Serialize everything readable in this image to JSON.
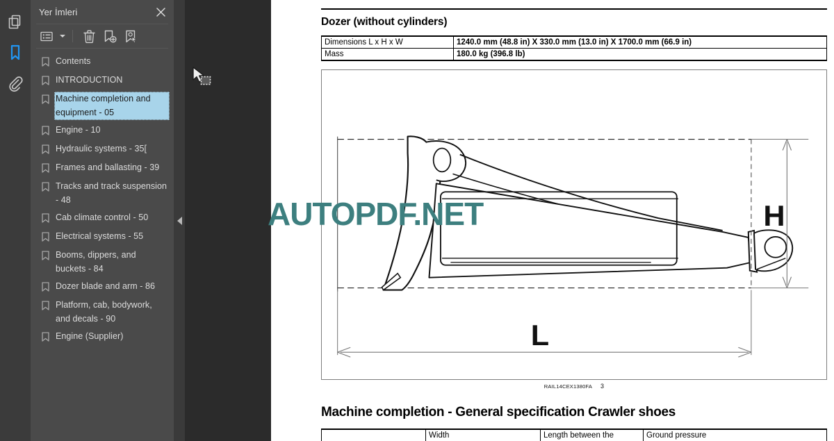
{
  "rail": {
    "items": [
      {
        "name": "pages-icon",
        "label": "Pages",
        "active": false
      },
      {
        "name": "bookmark-icon",
        "label": "Bookmarks",
        "active": true
      },
      {
        "name": "attachment-icon",
        "label": "Attachments",
        "active": false
      }
    ]
  },
  "panel": {
    "title": "Yer İmleri",
    "close_label": "✕",
    "toolbar": {
      "list_view_label": "List view options",
      "caret_label": "▾",
      "delete_label": "Delete bookmark",
      "add_label": "Add bookmark",
      "select_label": "Select bookmark"
    },
    "bookmarks": [
      {
        "label": "Contents",
        "selected": false
      },
      {
        "label": "INTRODUCTION",
        "selected": false
      },
      {
        "label": "Machine completion and equipment - 05",
        "selected": true
      },
      {
        "label": "Engine - 10",
        "selected": false
      },
      {
        "label": "Hydraulic systems - 35[",
        "selected": false
      },
      {
        "label": "Frames and ballasting - 39",
        "selected": false
      },
      {
        "label": "Tracks and track suspension - 48",
        "selected": false
      },
      {
        "label": "Cab climate control - 50",
        "selected": false
      },
      {
        "label": "Electrical systems - 55",
        "selected": false
      },
      {
        "label": "Booms, dippers, and buckets - 84",
        "selected": false
      },
      {
        "label": "Dozer blade and arm - 86",
        "selected": false
      },
      {
        "label": "Platform, cab, bodywork, and decals - 90",
        "selected": false
      },
      {
        "label": "Engine (Supplier)",
        "selected": false
      }
    ]
  },
  "viewer": {
    "collapse_arrow_label": "◀"
  },
  "document": {
    "section_title": "Dozer (without cylinders)",
    "spec_table": {
      "rows": [
        {
          "key": "Dimensions L x H x W",
          "value": "1240.0 mm (48.8 in) X 330.0 mm (13.0 in) X 1700.0 mm (66.9 in)"
        },
        {
          "key": "Mass",
          "value": "180.0 kg (396.8 lb)"
        }
      ]
    },
    "figure": {
      "dimension_h": "H",
      "dimension_l": "L",
      "caption_code": "RAIL14CEX1380FA",
      "caption_page": "3"
    },
    "next_section_title": "Machine completion - General specification Crawler shoes",
    "next_table_headers": [
      "",
      "Width",
      "Length between the",
      "Ground pressure"
    ]
  },
  "watermark": {
    "text": "AUTOPDF.NET",
    "color": "#3d7f7f"
  },
  "colors": {
    "rail_bg": "#3b3b3b",
    "panel_bg": "#4a4a4a",
    "viewer_bg": "#2b2b2b",
    "accent": "#2196f3",
    "selection": "#a8d4ea"
  }
}
